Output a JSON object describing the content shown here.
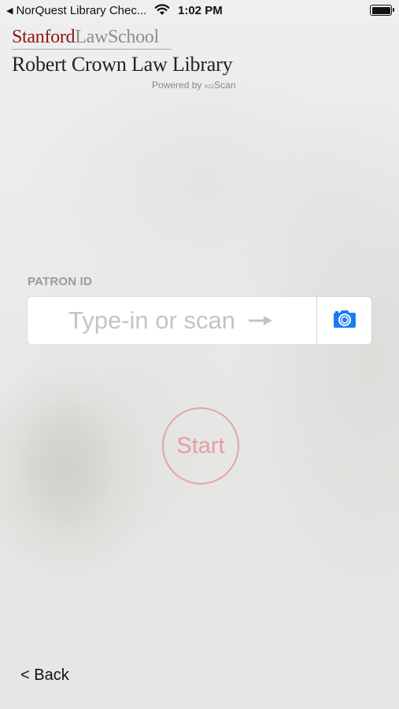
{
  "status_bar": {
    "back_app": "NorQuest Library Chec...",
    "time": "1:02 PM"
  },
  "header": {
    "logo_part1": "Stanford",
    "logo_part2": "LawSchool",
    "library_name": "Robert Crown Law Library",
    "powered_by": "Powered by",
    "powered_brand_small": "ezz",
    "powered_brand": "Scan"
  },
  "form": {
    "patron_label": "PATRON ID",
    "input_placeholder": "Type-in or scan",
    "input_value": ""
  },
  "start_label": "Start",
  "back_label": "< Back",
  "colors": {
    "stanford_red": "#8c1515",
    "camera_blue": "#1a7cf5",
    "start_red": "#e49ea3"
  },
  "icons": {
    "camera": "camera-icon",
    "arrow": "arrow-right-icon",
    "wifi": "wifi-icon",
    "battery": "battery-icon"
  }
}
